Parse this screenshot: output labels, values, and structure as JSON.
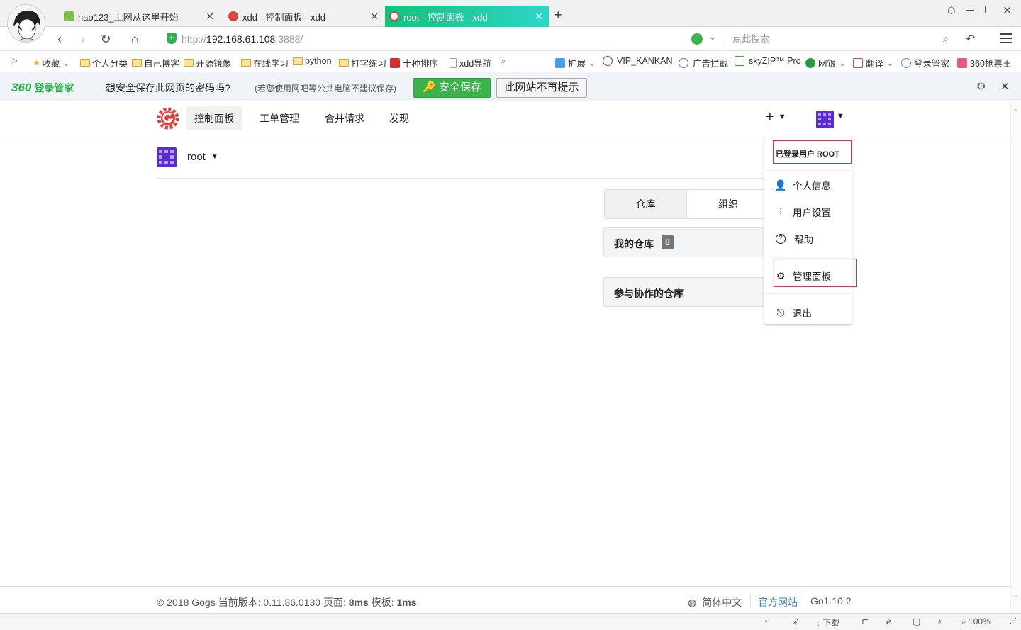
{
  "browser": {
    "tabs": [
      {
        "title": "hao123_上网从这里开始",
        "close": "✕"
      },
      {
        "title": "xdd - 控制面板 - xdd",
        "close": "✕"
      },
      {
        "title": "root - 控制面板 - xdd",
        "close": "✕"
      }
    ],
    "new_tab": "+",
    "url_prefix": "http://",
    "url_host": "192.168.61.108",
    "url_suffix": ":3888/",
    "search_placeholder": "点此搜索",
    "bookmarks": [
      "收藏",
      "个人分类",
      "自己博客",
      "开源镜像",
      "在线学习",
      "python",
      "打字练习",
      "十种排序",
      "xdd导航"
    ],
    "right_bookmarks": [
      "扩展",
      "VIP_KANKAN",
      "广告拦截",
      "skyZIP™ Pro",
      "网银",
      "翻译",
      "登录管家",
      "360抢票王"
    ]
  },
  "password_bar": {
    "brand": "360",
    "brand_label": "登录管家",
    "question": "想安全保存此网页的密码吗?",
    "hint": "(若您使用网吧等公共电脑不建议保存)",
    "save": "安全保存",
    "never": "此网站不再提示"
  },
  "gogs": {
    "nav": [
      "控制面板",
      "工单管理",
      "合并请求",
      "发现"
    ],
    "plus": "+",
    "context_user": "root",
    "tab_repos": "仓库",
    "tab_orgs": "组织",
    "my_repos": "我的仓库",
    "my_repos_count": "0",
    "collab_repos": "参与协作的仓库"
  },
  "dropdown": {
    "signed_in": "已登录用户 ROOT",
    "profile": "个人信息",
    "settings": "用户设置",
    "help": "帮助",
    "admin": "管理面板",
    "signout": "退出"
  },
  "footer": {
    "copyright": "© 2018 Gogs",
    "version_label": "当前版本:",
    "version": "0.11.86.0130",
    "page_label": "页面:",
    "page_time": "8ms",
    "tmpl_label": "模板:",
    "tmpl_time": "1ms",
    "language": "简体中文",
    "website": "官方网站",
    "go_version": "Go1.10.2"
  },
  "statusbar": {
    "download": "下载",
    "zoom": "100%"
  },
  "colors": {
    "active_tab": "#14c17a",
    "save_green": "#3bb34a",
    "gogs_red": "#d9453d",
    "link_blue": "#4183c4",
    "redbox": "#e03030",
    "avatar_purple": "#5a2bd4"
  }
}
